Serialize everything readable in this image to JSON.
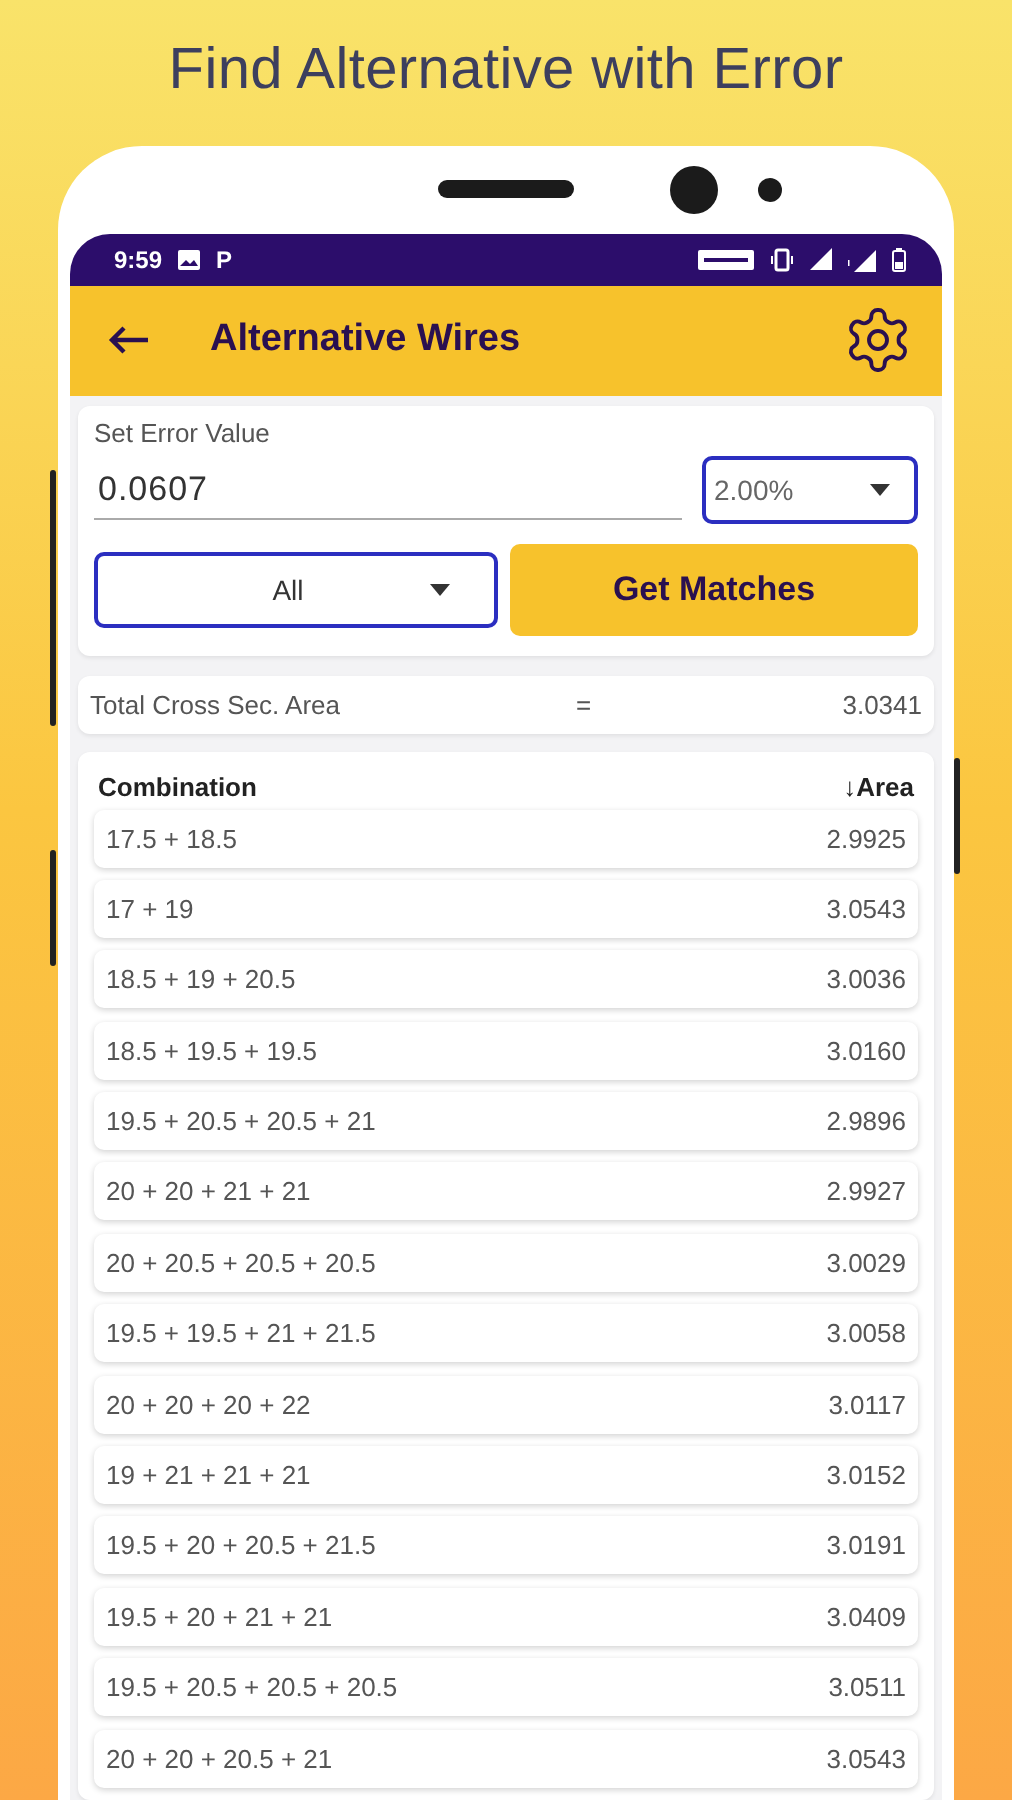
{
  "headline": "Find Alternative with Error",
  "status_bar": {
    "time": "9:59",
    "notification_glyph": "P"
  },
  "app_bar": {
    "title": "Alternative Wires"
  },
  "error_form": {
    "label": "Set Error Value",
    "value": "0.0607",
    "percent": "2.00%",
    "filter": "All",
    "button": "Get Matches"
  },
  "total": {
    "label": "Total Cross Sec. Area",
    "sign": "=",
    "value": "3.0341"
  },
  "table": {
    "columns": [
      "Combination",
      "↓Area"
    ],
    "rows": [
      [
        "17.5 + 18.5",
        "2.9925"
      ],
      [
        "17 + 19",
        "3.0543"
      ],
      [
        "18.5 + 19 + 20.5",
        "3.0036"
      ],
      [
        "18.5 + 19.5 + 19.5",
        "3.0160"
      ],
      [
        "19.5 + 20.5 + 20.5 + 21",
        "2.9896"
      ],
      [
        "20 + 20 + 21 + 21",
        "2.9927"
      ],
      [
        "20 + 20.5 + 20.5 + 20.5",
        "3.0029"
      ],
      [
        "19.5 + 19.5 + 21 + 21.5",
        "3.0058"
      ],
      [
        "20 + 20 + 20 + 22",
        "3.0117"
      ],
      [
        "19 + 21 + 21 + 21",
        "3.0152"
      ],
      [
        "19.5 + 20 + 20.5 + 21.5",
        "3.0191"
      ],
      [
        "19.5 + 20 + 21 + 21",
        "3.0409"
      ],
      [
        "19.5 + 20.5 + 20.5 + 20.5",
        "3.0511"
      ],
      [
        "20 + 20 + 20.5 + 21",
        "3.0543"
      ]
    ]
  }
}
